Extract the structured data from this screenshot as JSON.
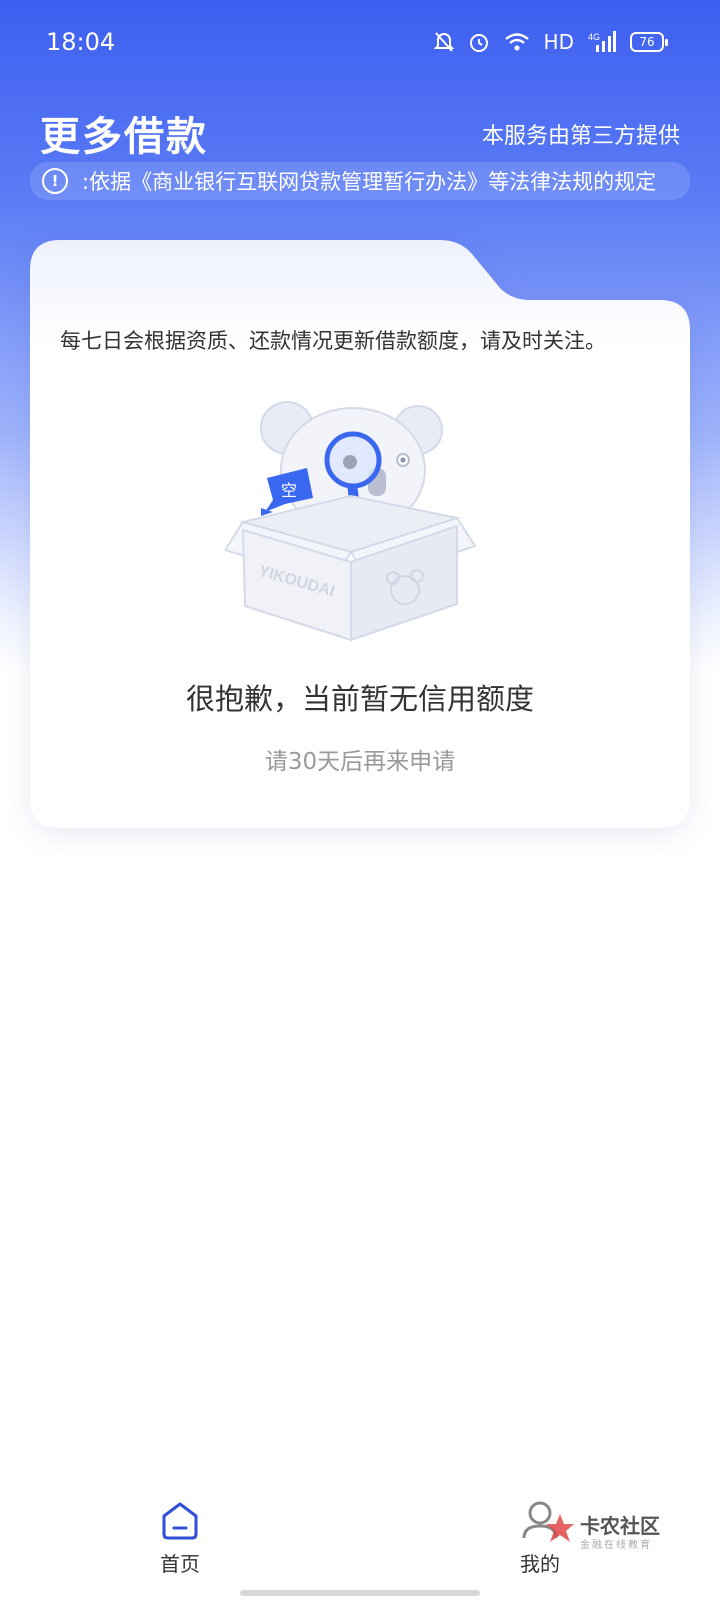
{
  "status_bar": {
    "time": "18:04",
    "network_label": "HD",
    "signal_label": "4G",
    "battery": "76"
  },
  "header": {
    "title": "更多借款",
    "provider_note": "本服务由第三方提供"
  },
  "notice": {
    "icon": "info-circle-icon",
    "text": ":依据《商业银行互联网贷款管理暂行办法》等法律法规的规定"
  },
  "card": {
    "tip": "每七日会根据资质、还款情况更新借款额度，请及时关注。",
    "illustration_box_text": "YIKOUDAI",
    "illustration_bubble_text": "空",
    "empty_title": "很抱歉，当前暂无信用额度",
    "empty_subtitle": "请30天后再来申请"
  },
  "bottom_nav": {
    "items": [
      {
        "label": "首页",
        "icon": "home-icon",
        "active": true
      },
      {
        "label": "我的",
        "icon": "profile-icon",
        "active": false
      }
    ]
  },
  "watermark": {
    "title": "卡农社区",
    "subtitle": "金融在线教育"
  },
  "colors": {
    "primary": "#3d5ff0",
    "text": "#333333",
    "muted": "#999999"
  }
}
